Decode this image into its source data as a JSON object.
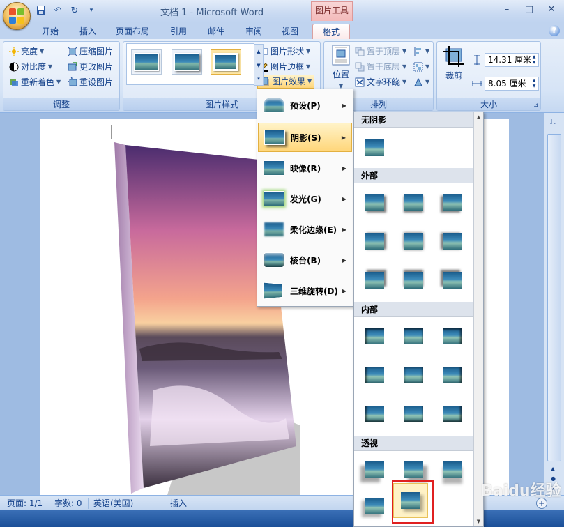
{
  "window": {
    "title": "文档 1 - Microsoft Word",
    "context_tab_header": "图片工具",
    "controls": {
      "minimize": "–",
      "maximize": "□",
      "close": "✕"
    }
  },
  "tabs": [
    {
      "label": "开始"
    },
    {
      "label": "插入"
    },
    {
      "label": "页面布局"
    },
    {
      "label": "引用"
    },
    {
      "label": "邮件"
    },
    {
      "label": "审阅"
    },
    {
      "label": "视图"
    },
    {
      "label": "格式",
      "active": true
    }
  ],
  "ribbon": {
    "adjust": {
      "label": "调整",
      "brightness": "亮度",
      "contrast": "对比度",
      "recolor": "重新着色",
      "compress": "压缩图片",
      "change": "更改图片",
      "reset": "重设图片"
    },
    "styles": {
      "label": "图片样式",
      "shape": "图片形状",
      "border": "图片边框",
      "effects": "图片效果"
    },
    "arrange": {
      "label": "排列",
      "position": "位置",
      "bring_front": "置于顶层",
      "send_back": "置于底层",
      "wrap": "文字环绕"
    },
    "size": {
      "label": "大小",
      "crop": "裁剪",
      "height": "14.31 厘米",
      "width": "8.05 厘米"
    }
  },
  "effects_menu": [
    {
      "label": "预设(P)"
    },
    {
      "label": "阴影(S)",
      "hover": true
    },
    {
      "label": "映像(R)"
    },
    {
      "label": "发光(G)"
    },
    {
      "label": "柔化边缘(E)"
    },
    {
      "label": "棱台(B)"
    },
    {
      "label": "三维旋转(D)"
    }
  ],
  "shadow_gallery": {
    "no_shadow": "无阴影",
    "outer": "外部",
    "inner": "内部",
    "perspective": "透视"
  },
  "statusbar": {
    "page": "页面: 1/1",
    "words": "字数: 0",
    "language": "英语(美国)",
    "mode": "插入"
  },
  "watermark": "Baidu经验",
  "colors": {
    "accent": "#15428b",
    "context_tab": "#f3b9b9",
    "hover": "#ffd67a",
    "highlight_box": "#e02020"
  }
}
